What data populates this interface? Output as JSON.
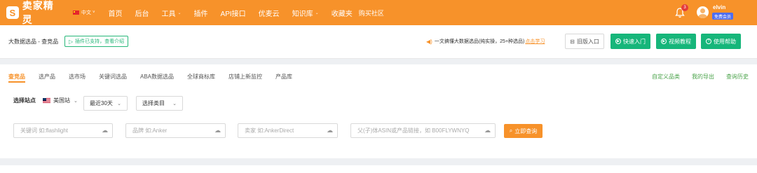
{
  "brand": {
    "logo_letter": "S",
    "name": "卖家精灵"
  },
  "lang": {
    "label": "中文",
    "caret": "˅"
  },
  "nav": [
    {
      "label": "首页",
      "caret": ""
    },
    {
      "label": "后台",
      "caret": ""
    },
    {
      "label": "工具",
      "caret": "⌄"
    },
    {
      "label": "插件",
      "caret": ""
    },
    {
      "label": "API接口",
      "caret": ""
    },
    {
      "label": "优麦云",
      "caret": ""
    },
    {
      "label": "知识库",
      "caret": "⌄"
    },
    {
      "label": "收藏夹",
      "caret": ""
    }
  ],
  "top_right": {
    "buy": "购买",
    "community": "社区",
    "bell_count": "3",
    "username": "elvin",
    "vip": "免费会员"
  },
  "header": {
    "crumb": "大数据选品 - 查竞品",
    "plugin_chip": "插件已支持，查看介绍",
    "notice_text": "一文搞懂大数据选品(纯实操，25+种选品)",
    "notice_link": "点击学习",
    "old_entry": "旧版入口",
    "quick_start": "快速入门",
    "video_tutorial": "视频教程",
    "help": "使用帮助"
  },
  "tabs": [
    {
      "label": "查竞品",
      "active": true
    },
    {
      "label": "选产品",
      "active": false
    },
    {
      "label": "选市场",
      "active": false
    },
    {
      "label": "关键词选品",
      "active": false
    },
    {
      "label": "ABA数据选品",
      "active": false
    },
    {
      "label": "全球商标库",
      "active": false
    },
    {
      "label": "店铺上新监控",
      "active": false
    },
    {
      "label": "产品库",
      "active": false
    }
  ],
  "tab_links": [
    "自定义品类",
    "我的导出",
    "查询历史"
  ],
  "filters": {
    "site_label": "选择站点",
    "site_value": "美国站",
    "period_value": "最近30天",
    "category_value": "选择类目"
  },
  "inputs": {
    "keyword_placeholder": "关键词 如:flashlight",
    "brand_placeholder": "品牌 如:Anker",
    "seller_placeholder": "卖家 如:AnkerDirect",
    "asin_placeholder": "父(子)体ASIN或产品链接，如 B00FLYWNYQ",
    "search_button": "立即查询"
  },
  "colors": {
    "brand_orange": "#f7922a",
    "green": "#16b67a",
    "vip_blue": "#4e6ef2"
  },
  "icons": {
    "speaker": "speaker-icon",
    "cloud": "cloud-upload-icon",
    "search": "search-icon",
    "bell": "bell-icon"
  }
}
